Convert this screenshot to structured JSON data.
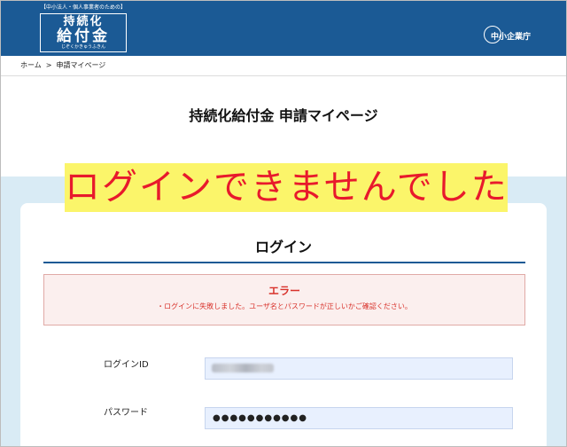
{
  "header": {
    "logo_tagline": "【中小法人・個人事業者のための】",
    "logo_line1": "持続化",
    "logo_line2": "給付金",
    "logo_ruby": "じぞくかきゅうふきん",
    "agency": "中小企業庁"
  },
  "breadcrumb": {
    "home": "ホーム",
    "separator": ">",
    "current": "申請マイページ"
  },
  "page_title": "持続化給付金 申請マイページ",
  "banner": {
    "text": "ログインできませんでした",
    "text_color": "#e8192c",
    "background": "#fbf56a"
  },
  "login_card": {
    "title": "ログイン",
    "error": {
      "title": "エラー",
      "message": "・ログインに失敗しました。ユーザ名とパスワードが正しいかご確認ください。"
    },
    "fields": {
      "login_id_label": "ログインID",
      "login_id_value": "",
      "password_label": "パスワード",
      "password_value": "●●●●●●●●●●●"
    }
  },
  "colors": {
    "header_bg": "#1b5a95",
    "page_bg_area": "#d9ebf5",
    "error_text": "#d8322b",
    "error_bg": "#fbefee",
    "input_bg": "#e8f0fe"
  }
}
